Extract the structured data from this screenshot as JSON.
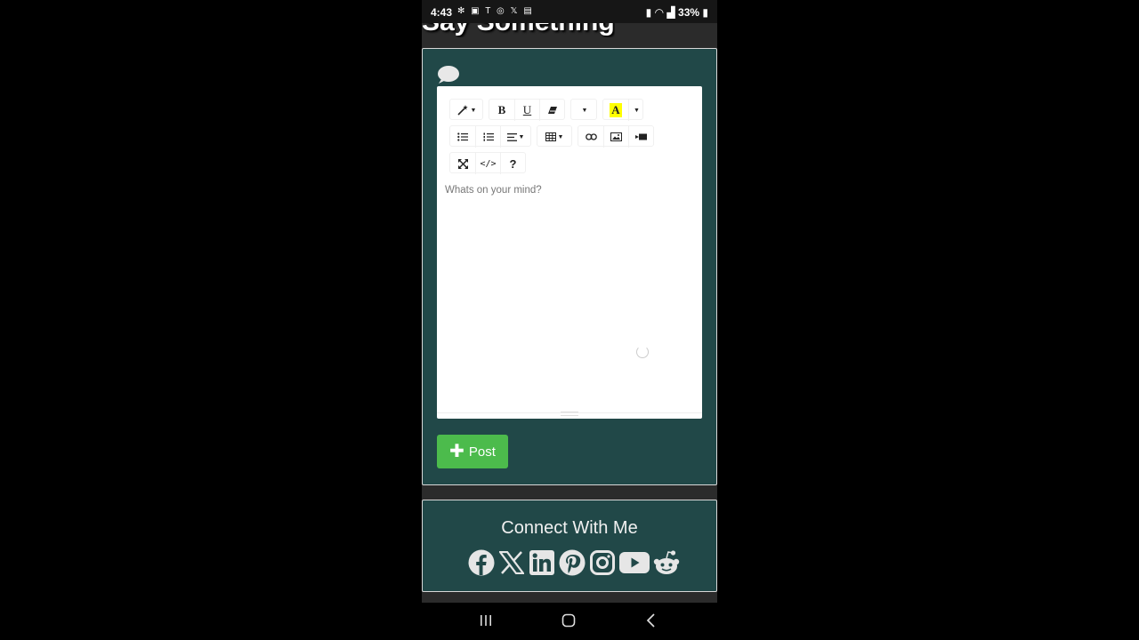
{
  "status_bar": {
    "time": "4:43",
    "left_icons": [
      "fan-icon",
      "linkedin-icon",
      "app-icon",
      "screen-record-icon",
      "x-icon",
      "gallery-icon"
    ],
    "battery_percent": "33%"
  },
  "page": {
    "heading": "Say Something"
  },
  "post_card": {
    "icon": "speech-bubble-icon",
    "toolbar": {
      "row1": [
        "magic-wand-icon",
        "bold-icon",
        "underline-icon",
        "eraser-icon",
        "font-size-dropdown",
        "font-color-icon",
        "color-dropdown"
      ],
      "row2": [
        "bullet-list-icon",
        "numbered-list-icon",
        "align-icon",
        "table-icon",
        "link-icon",
        "picture-icon",
        "video-icon"
      ],
      "row3": [
        "fullscreen-icon",
        "code-view-icon",
        "help-icon"
      ],
      "bold_label": "B",
      "underline_label": "U",
      "font_color_label": "A",
      "code_label": "</>",
      "help_label": "?"
    },
    "editor_placeholder": "Whats on your mind?",
    "post_button_label": "Post"
  },
  "connect": {
    "title": "Connect With Me",
    "icons": [
      "facebook-icon",
      "x-icon",
      "linkedin-icon",
      "pinterest-icon",
      "instagram-icon",
      "youtube-icon",
      "reddit-icon"
    ]
  },
  "nav_bar": {
    "buttons": [
      "recent-apps-icon",
      "home-icon",
      "back-icon"
    ]
  }
}
